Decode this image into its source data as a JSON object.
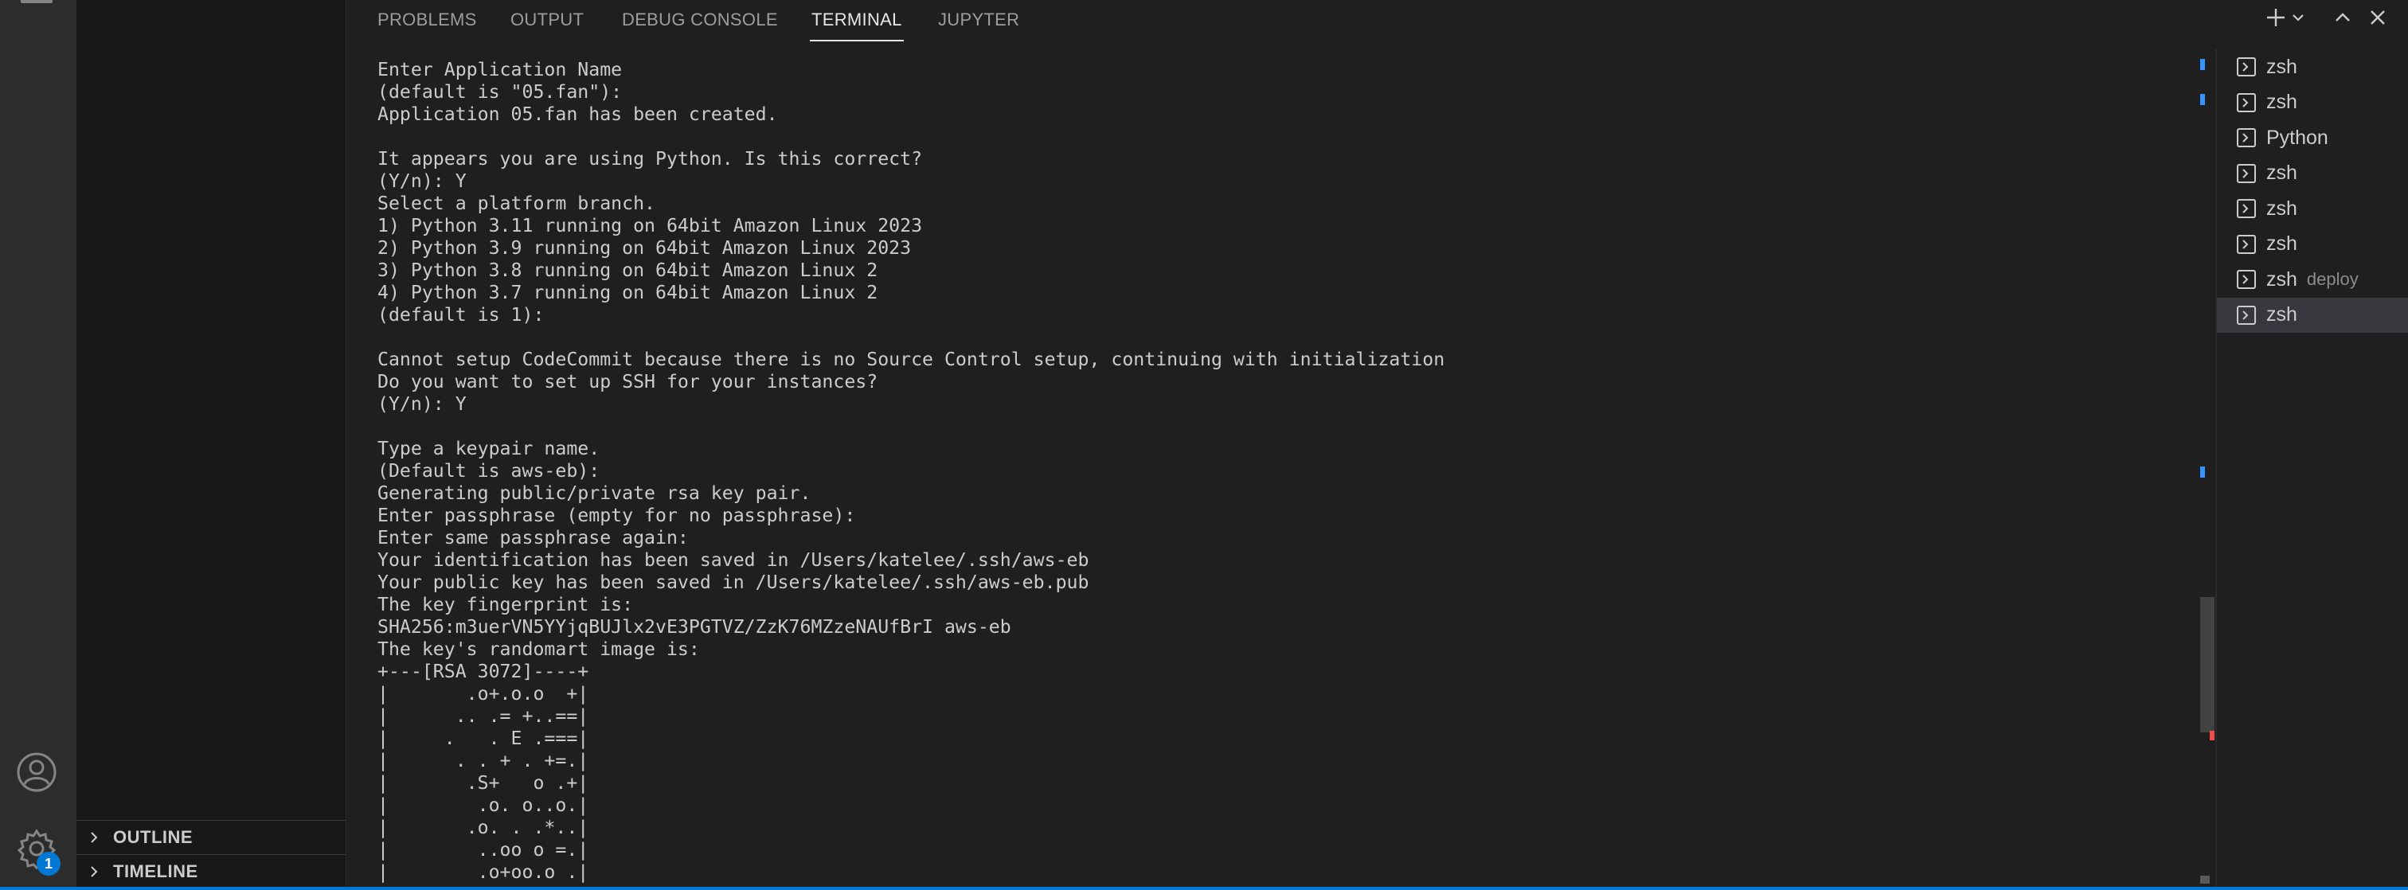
{
  "activity_bar": {
    "settings_badge": "1"
  },
  "sidebar": {
    "sections": [
      {
        "label": "OUTLINE"
      },
      {
        "label": "TIMELINE"
      }
    ]
  },
  "panel": {
    "tabs": [
      {
        "label": "PROBLEMS"
      },
      {
        "label": "OUTPUT"
      },
      {
        "label": "DEBUG CONSOLE"
      },
      {
        "label": "TERMINAL",
        "active": true
      },
      {
        "label": "JUPYTER"
      }
    ]
  },
  "terminal": {
    "lines": [
      "Enter Application Name",
      "(default is \"05.fan\"):",
      "Application 05.fan has been created.",
      "",
      "It appears you are using Python. Is this correct?",
      "(Y/n): Y",
      "Select a platform branch.",
      "1) Python 3.11 running on 64bit Amazon Linux 2023",
      "2) Python 3.9 running on 64bit Amazon Linux 2023",
      "3) Python 3.8 running on 64bit Amazon Linux 2",
      "4) Python 3.7 running on 64bit Amazon Linux 2",
      "(default is 1):",
      "",
      "Cannot setup CodeCommit because there is no Source Control setup, continuing with initialization",
      "Do you want to set up SSH for your instances?",
      "(Y/n): Y",
      "",
      "Type a keypair name.",
      "(Default is aws-eb):",
      "Generating public/private rsa key pair.",
      "Enter passphrase (empty for no passphrase):",
      "Enter same passphrase again:",
      "Your identification has been saved in /Users/katelee/.ssh/aws-eb",
      "Your public key has been saved in /Users/katelee/.ssh/aws-eb.pub",
      "The key fingerprint is:",
      "SHA256:m3uerVN5YYjqBUJlx2vE3PGTVZ/ZzK76MZzeNAUfBrI aws-eb",
      "The key's randomart image is:",
      "+---[RSA 3072]----+",
      "|       .o+.o.o  +|",
      "|      .. .= +..==|",
      "|     .   . E .===|",
      "|      . . + . +=.|",
      "|       .S+   o .+|",
      "|        .o. o..o.|",
      "|       .o. . .*..|",
      "|        ..oo o =.|",
      "|        .o+oo.o .|"
    ]
  },
  "terminal_list": {
    "items": [
      {
        "name": "zsh",
        "desc": ""
      },
      {
        "name": "zsh",
        "desc": ""
      },
      {
        "name": "Python",
        "desc": ""
      },
      {
        "name": "zsh",
        "desc": ""
      },
      {
        "name": "zsh",
        "desc": ""
      },
      {
        "name": "zsh",
        "desc": ""
      },
      {
        "name": "zsh",
        "desc": "deploy"
      },
      {
        "name": "zsh",
        "desc": "",
        "selected": true
      }
    ]
  },
  "colors": {
    "accent": "#0078d4",
    "background": "#1f1f1f",
    "text": "#cccccc"
  },
  "icons": {
    "activity_bar": [
      "accounts-icon",
      "settings-gear-icon"
    ],
    "sidebar": [
      "chevron-right-icon"
    ],
    "panel_actions": [
      "plus-icon",
      "chevron-down-icon",
      "chevron-up-icon",
      "close-icon"
    ],
    "terminal_list": [
      "terminal-icon"
    ]
  }
}
